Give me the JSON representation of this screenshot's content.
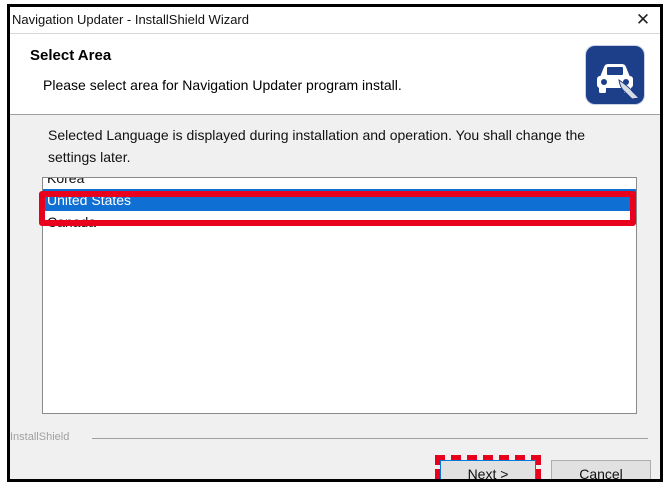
{
  "window": {
    "title": "Navigation Updater - InstallShield Wizard",
    "close_glyph": "✕"
  },
  "header": {
    "title": "Select Area",
    "subtitle": "Please select area for Navigation Updater program install.",
    "icon": "car-navigation-icon"
  },
  "body": {
    "intro": "Selected Language is displayed during installation and operation. You shall change the settings later."
  },
  "area_list": {
    "items": [
      {
        "label": "Korea",
        "selected": false
      },
      {
        "label": "United States",
        "selected": true
      },
      {
        "label": "Canada",
        "selected": false
      }
    ]
  },
  "footer": {
    "brand_label": "InstallShield",
    "next_label": "Next >",
    "cancel_label": "Cancel"
  },
  "colors": {
    "selection": "#0f6fd2",
    "highlight_annotation": "#e8001c",
    "icon_background": "#1d3f8a"
  }
}
